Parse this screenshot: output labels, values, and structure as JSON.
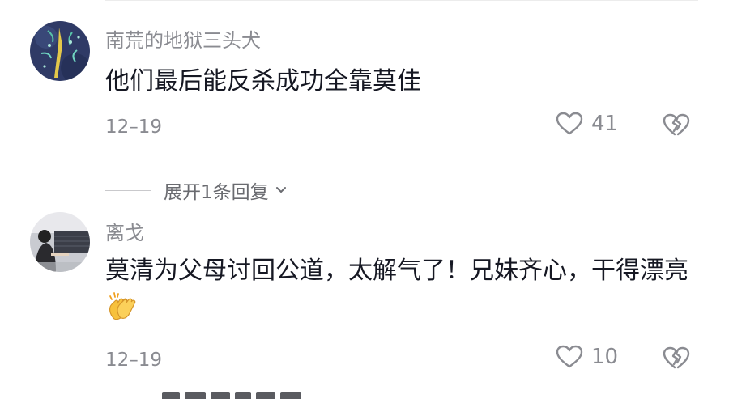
{
  "comments": [
    {
      "username": "南荒的地狱三头犬",
      "text": "他们最后能反杀成功全靠莫佳",
      "date": "12–19",
      "likes": "41",
      "icons": {
        "like": "heart-outline-icon",
        "dislike": "broken-heart-icon"
      }
    },
    {
      "username": "离戈",
      "text": "莫清为父母讨回公道，太解气了！兄妹齐心，干得漂亮",
      "emoji": "clapping-hands-emoji",
      "date": "12–19",
      "likes": "10",
      "icons": {
        "like": "heart-outline-icon",
        "dislike": "broken-heart-icon"
      }
    }
  ],
  "replies_toggle": {
    "label": "展开1条回复",
    "icon": "chevron-down-icon"
  },
  "colors": {
    "text": "#161823",
    "muted": "#8a8b91",
    "avatar1_bg": "#2f3a66",
    "avatar2_bg": "#d8d8dc"
  }
}
